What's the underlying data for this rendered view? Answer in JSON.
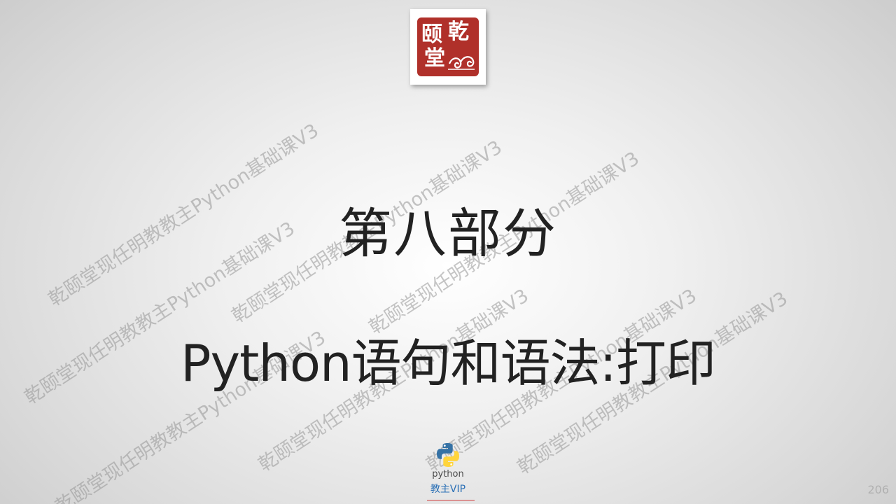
{
  "logo": {
    "chars": [
      "乾",
      "颐",
      "堂"
    ]
  },
  "watermark_text": "乾颐堂现任明教教主Python基础课V3",
  "title": {
    "line1": "第八部分",
    "line2": "Python语句和语法:打印"
  },
  "badge": {
    "python_word": "python",
    "vip_label": "教主VIP"
  },
  "page_number": "206",
  "colors": {
    "seal_red": "#b0302a",
    "title_text": "#222222",
    "vip_blue": "#2a6fb5",
    "python_blue": "#3572a5",
    "python_yellow": "#ffd43b"
  }
}
